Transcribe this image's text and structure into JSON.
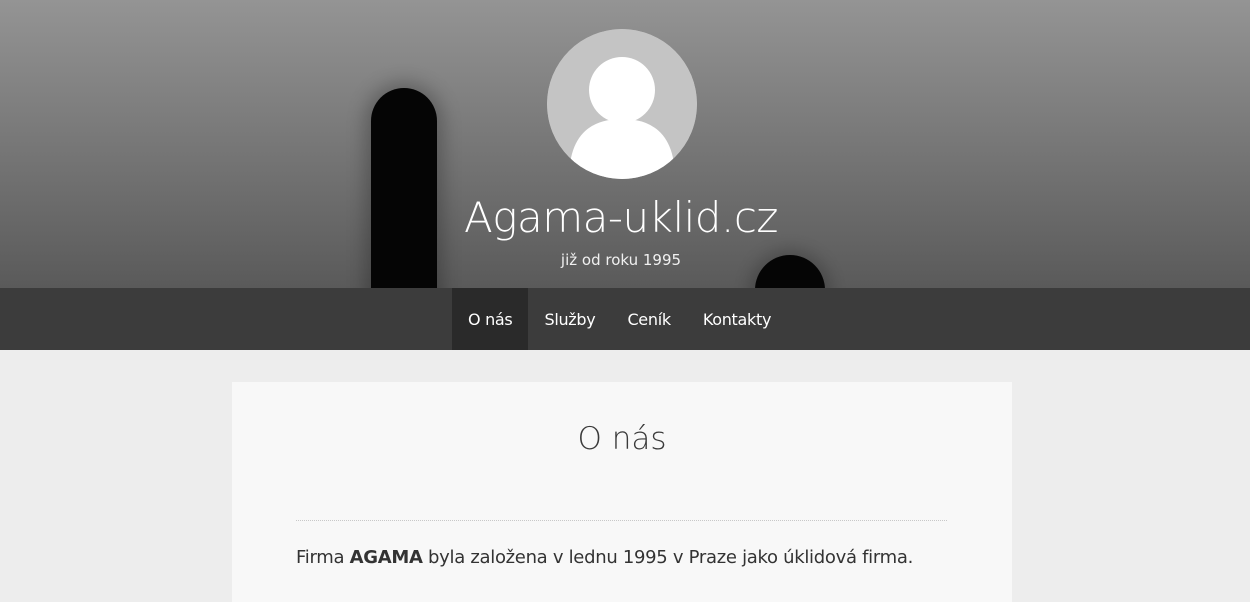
{
  "header": {
    "site_title": "Agama-uklid.cz",
    "tagline": "již od roku 1995",
    "avatar_icon": "user-placeholder-icon"
  },
  "nav": {
    "items": [
      {
        "label": "O nás",
        "active": true
      },
      {
        "label": "Služby",
        "active": false
      },
      {
        "label": "Ceník",
        "active": false
      },
      {
        "label": "Kontakty",
        "active": false
      }
    ]
  },
  "content": {
    "heading": "O nás",
    "intro": {
      "prefix": "Firma ",
      "bold": "AGAMA",
      "suffix": " byla založena v lednu 1995 v Praze jako úklidová firma."
    }
  },
  "colors": {
    "nav_bg": "#3c3c3c",
    "nav_active_bg": "#2a2a2a",
    "page_bg": "#ededed",
    "card_bg": "#f8f8f8"
  }
}
